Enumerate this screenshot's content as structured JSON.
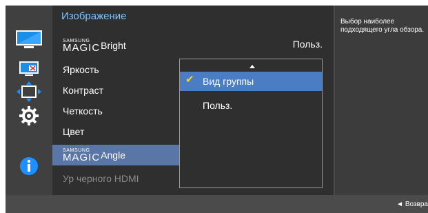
{
  "menu": {
    "title": "Изображение",
    "magic_brand": "SAMSUNG",
    "magic_word": "MAGIC",
    "items": [
      {
        "label": "Bright",
        "value": "Польз."
      },
      {
        "label": "Яркость"
      },
      {
        "label": "Контраст"
      },
      {
        "label": "Четкость"
      },
      {
        "label": "Цвет"
      },
      {
        "label": "Angle"
      },
      {
        "label": "Ур черного HDMI"
      }
    ]
  },
  "dropdown": {
    "options": [
      "Вид группы",
      "Польз."
    ],
    "selected": "Вид группы"
  },
  "help": {
    "text": "Выбор наиболее подходящего угла обзора."
  },
  "footer": {
    "return_label": "◄ Возвра"
  },
  "icons": [
    "picture-icon",
    "screen-adjust-icon",
    "position-size-icon",
    "settings-gear-icon",
    "information-icon"
  ],
  "colors": {
    "title": "#7cc4ff",
    "selected_row": "#5a76a6",
    "dropdown_selected": "#4a7dc4",
    "check": "#ffd21e",
    "info_icon": "#1e8fff"
  }
}
